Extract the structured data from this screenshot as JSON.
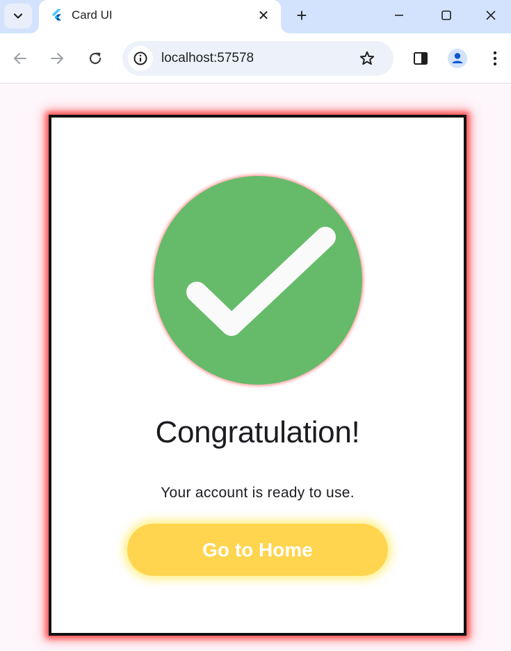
{
  "browser": {
    "tab": {
      "title": "Card UI",
      "favicon": "flutter-icon",
      "close_glyph": "✕"
    },
    "new_tab_glyph": "+",
    "window_controls": [
      "minimize-icon",
      "maximize-icon",
      "close-icon"
    ],
    "toolbar": {
      "back_icon": "back-arrow-icon",
      "forward_icon": "forward-arrow-icon",
      "reload_icon": "reload-icon",
      "url": "localhost:57578",
      "site_info_icon": "info-icon",
      "bookmark_icon": "star-icon",
      "side_panel_icon": "side-panel-icon",
      "profile_icon": "profile-icon",
      "menu_icon": "kebab-menu-icon"
    }
  },
  "card": {
    "icon": "checkmark-icon",
    "title": "Congratulation!",
    "message": "Your account is ready to use.",
    "button_label": "Go to Home"
  },
  "colors": {
    "success": "#66bb6a",
    "button": "#ffd54f",
    "card_glow": "#ff3c3c",
    "tabstrip": "#d3e3fd",
    "page_background": "#fdf6fb"
  }
}
